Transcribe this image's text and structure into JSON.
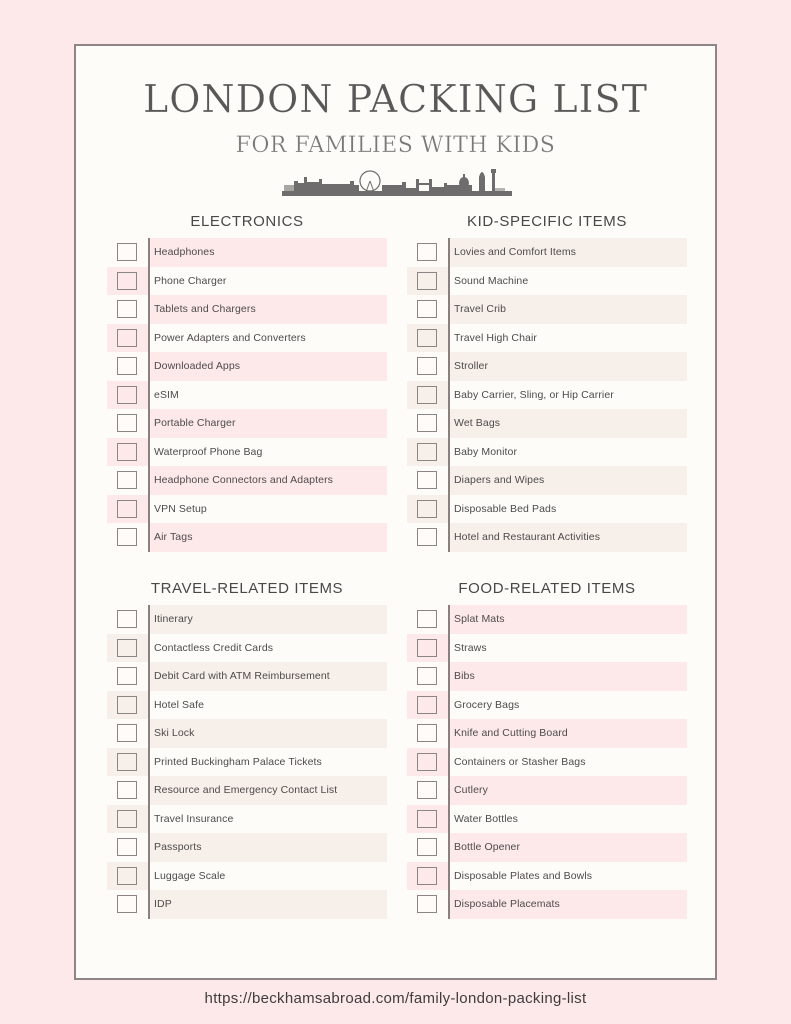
{
  "header": {
    "title": "LONDON PACKING LIST",
    "subtitle": "FOR FAMILIES WITH KIDS",
    "image": "london-skyline-icon"
  },
  "colors": {
    "page_background": "#fde9ea",
    "sheet_background": "#fdfcf9",
    "pink_stripe": "#fde9ea",
    "beige_stripe": "#f6efea",
    "border": "#8e8686",
    "text": "#4e4b4b"
  },
  "sections": [
    {
      "title": "ELECTRONICS",
      "stripe": "pink",
      "items": [
        "Headphones",
        "Phone Charger",
        "Tablets and Chargers",
        "Power Adapters and Converters",
        "Downloaded Apps",
        "eSIM",
        "Portable Charger",
        "Waterproof Phone Bag",
        "Headphone Connectors and Adapters",
        "VPN Setup",
        "Air Tags"
      ]
    },
    {
      "title": "KID-SPECIFIC ITEMS",
      "stripe": "beige",
      "items": [
        "Lovies and Comfort Items",
        "Sound Machine",
        "Travel Crib",
        "Travel High Chair",
        "Stroller",
        "Baby Carrier, Sling, or Hip Carrier",
        "Wet Bags",
        "Baby Monitor",
        "Diapers and Wipes",
        "Disposable Bed Pads",
        "Hotel and Restaurant Activities"
      ]
    },
    {
      "title": "TRAVEL-RELATED ITEMS",
      "stripe": "beige",
      "items": [
        "Itinerary",
        "Contactless Credit Cards",
        "Debit Card with ATM Reimbursement",
        "Hotel Safe",
        "Ski Lock",
        "Printed Buckingham Palace Tickets",
        "Resource and Emergency Contact List",
        "Travel Insurance",
        "Passports",
        "Luggage Scale",
        "IDP"
      ]
    },
    {
      "title": "FOOD-RELATED ITEMS",
      "stripe": "pink",
      "items": [
        "Splat Mats",
        "Straws",
        "Bibs",
        "Grocery Bags",
        "Knife and Cutting Board",
        "Containers or Stasher Bags",
        "Cutlery",
        "Water Bottles",
        "Bottle Opener",
        "Disposable Plates and Bowls",
        "Disposable Placemats"
      ]
    }
  ],
  "footer": {
    "url": "https://beckhamsabroad.com/family-london-packing-list"
  }
}
